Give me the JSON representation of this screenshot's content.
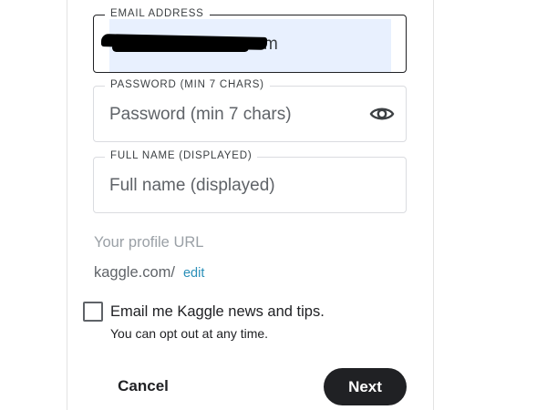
{
  "email": {
    "label": "EMAIL ADDRESS",
    "visible_value_suffix": "m"
  },
  "password": {
    "label": "PASSWORD (MIN 7 CHARS)",
    "placeholder": "Password (min 7 chars)",
    "icon": "eye-icon"
  },
  "full_name": {
    "label": "FULL NAME (DISPLAYED)",
    "placeholder": "Full name (displayed)"
  },
  "profile_url": {
    "label": "Your profile URL",
    "prefix": "kaggle.com/",
    "edit_link": "edit"
  },
  "newsletter": {
    "checked": false,
    "label": "Email me Kaggle news and tips.",
    "subtext": "You can opt out at any time."
  },
  "actions": {
    "cancel": "Cancel",
    "next": "Next"
  },
  "colors": {
    "autofill_bg": "#e8f0fe",
    "link": "#2a8fb8",
    "primary_button": "#202124"
  }
}
